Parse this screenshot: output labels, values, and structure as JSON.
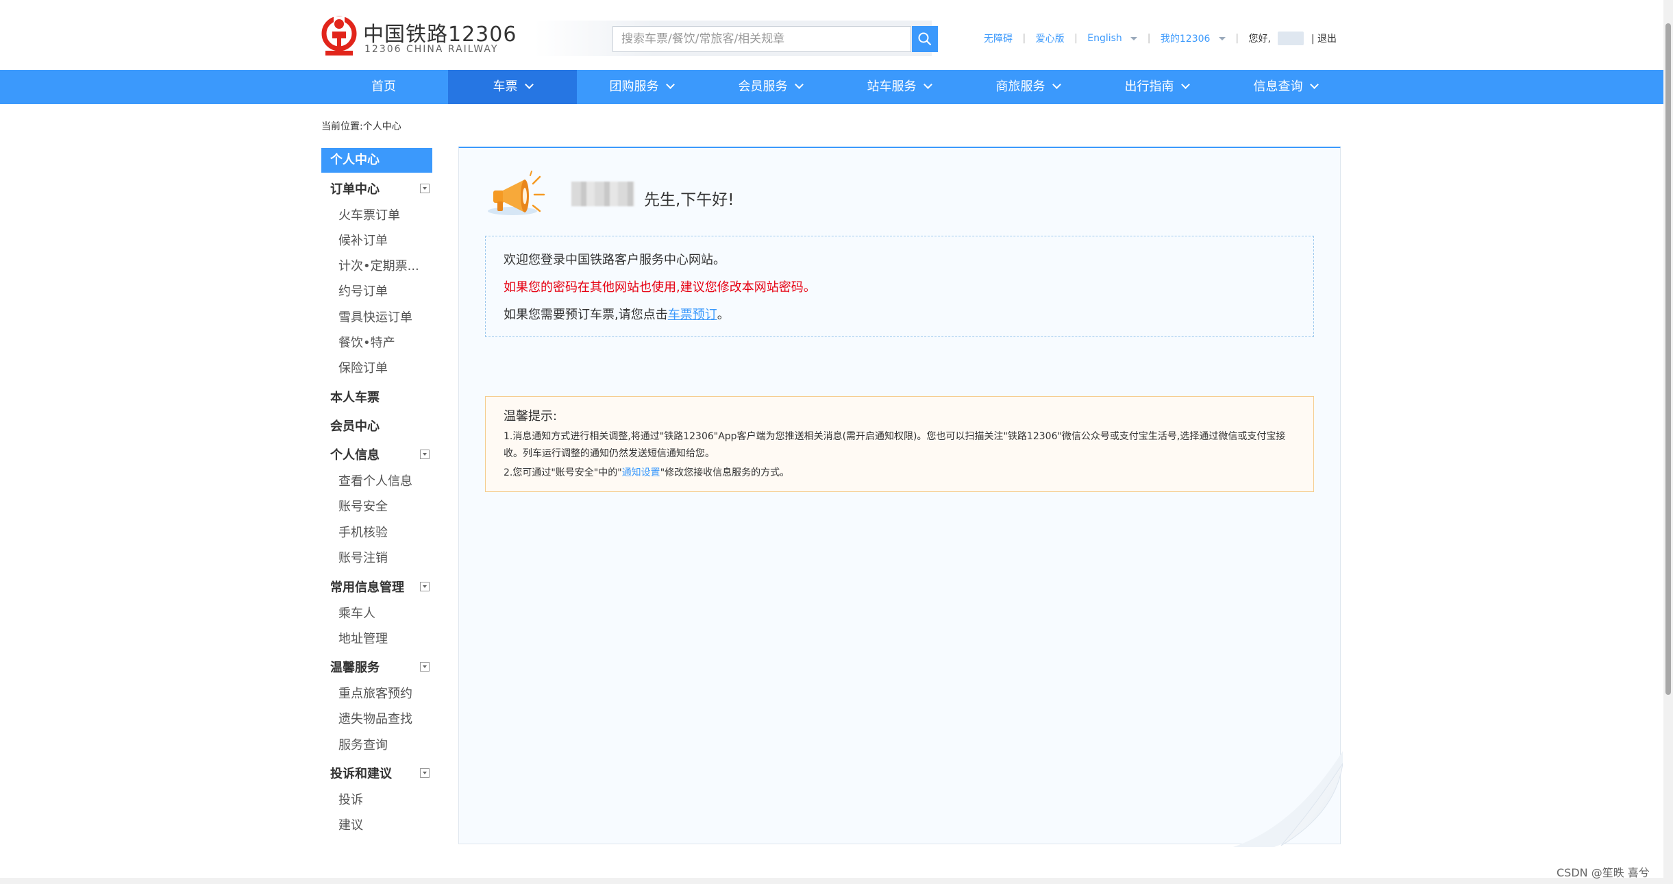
{
  "header": {
    "logo_cn": "中国铁路12306",
    "logo_en": "12306 CHINA RAILWAY",
    "search_placeholder": "搜索车票/餐饮/常旅客/相关规章",
    "top_links": {
      "accessible": "无障碍",
      "elder": "爱心版",
      "english": "English",
      "my12306": "我的12306",
      "hello": "您好,",
      "logout": "| 退出"
    }
  },
  "nav": {
    "items": [
      {
        "label": "首页"
      },
      {
        "label": "车票"
      },
      {
        "label": "团购服务"
      },
      {
        "label": "会员服务"
      },
      {
        "label": "站车服务"
      },
      {
        "label": "商旅服务"
      },
      {
        "label": "出行指南"
      },
      {
        "label": "信息查询"
      }
    ]
  },
  "breadcrumb": "当前位置:个人中心",
  "sidebar": {
    "top": "个人中心",
    "order_center": {
      "title": "订单中心",
      "items": [
        "火车票订单",
        "候补订单",
        "计次•定期票...",
        "约号订单",
        "雪具快运订单",
        "餐饮•特产",
        "保险订单"
      ]
    },
    "my_tickets": "本人车票",
    "member_center": "会员中心",
    "personal_info": {
      "title": "个人信息",
      "items": [
        "查看个人信息",
        "账号安全",
        "手机核验",
        "账号注销"
      ]
    },
    "common_info": {
      "title": "常用信息管理",
      "items": [
        "乘车人",
        "地址管理"
      ]
    },
    "warm_service": {
      "title": "温馨服务",
      "items": [
        "重点旅客预约",
        "遗失物品查找",
        "服务查询"
      ]
    },
    "complaint": {
      "title": "投诉和建议",
      "items": [
        "投诉",
        "建议"
      ]
    }
  },
  "main": {
    "greeting": "先生,下午好!",
    "welcome": {
      "line1": "欢迎您登录中国铁路客户服务中心网站。",
      "line2": "如果您的密码在其他网站也使用,建议您修改本网站密码。",
      "line3_pre": "如果您需要预订车票,请您点击",
      "line3_link": "车票预订",
      "line3_post": "。"
    },
    "tips": {
      "title": "温馨提示:",
      "line1": "1.消息通知方式进行相关调整,将通过\"铁路12306\"App客户端为您推送相关消息(需开启通知权限)。您也可以扫描关注\"铁路12306\"微信公众号或支付宝生活号,选择通过微信或支付宝接收。列车运行调整的通知仍然发送短信通知给您。",
      "line2_pre": "2.您可通过\"账号安全\"中的\"",
      "line2_link": "通知设置",
      "line2_post": "\"修改您接收信息服务的方式。"
    }
  },
  "watermark": "CSDN @笙昳 喜兮",
  "colors": {
    "accent": "#3b99fc",
    "nav_active": "#2676e3",
    "warning": "#e60012",
    "tips_border": "#f5cc8f"
  }
}
